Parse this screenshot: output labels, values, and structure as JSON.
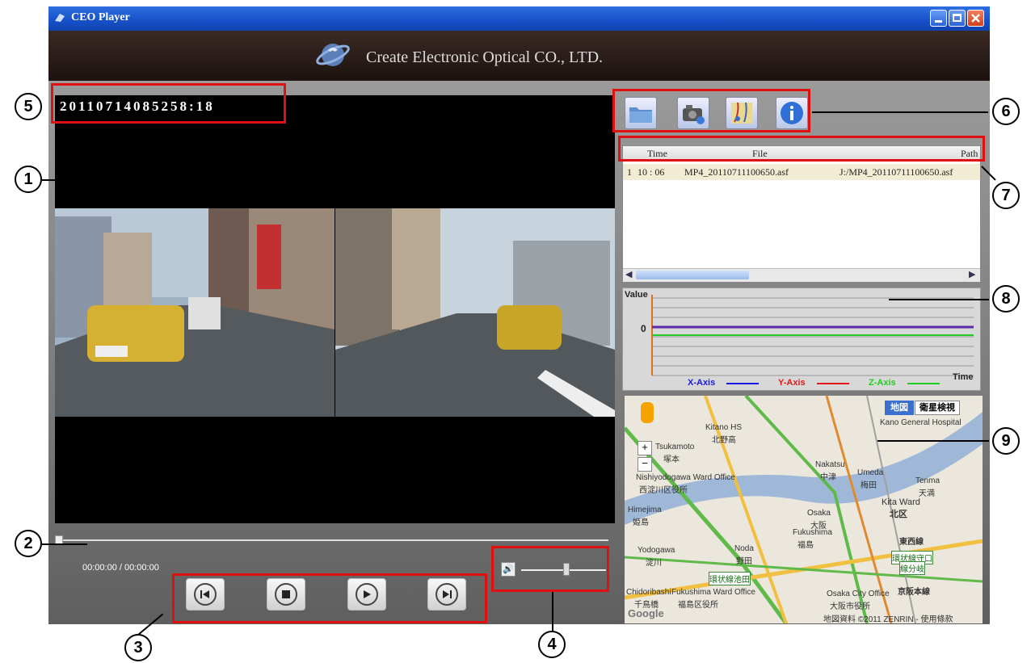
{
  "window": {
    "title": "CEO Player",
    "brand": "Create Electronic Optical CO., LTD."
  },
  "video": {
    "timestamp": "20110714085258:18",
    "time_display": "00:00:00 / 00:00:00"
  },
  "file_table": {
    "columns": [
      "Time",
      "File",
      "Path"
    ],
    "rows": [
      {
        "index": "1",
        "time": "10 : 06",
        "file": "MP4_20110711100650.asf",
        "path": "J:/MP4_20110711100650.asf"
      }
    ]
  },
  "graph": {
    "ylabel": "Value",
    "zero_label": "0",
    "xlabel": "Time",
    "legend": [
      {
        "name": "X-Axis",
        "color": "#1a1ae0"
      },
      {
        "name": "Y-Axis",
        "color": "#e01818"
      },
      {
        "name": "Z-Axis",
        "color": "#22cc22"
      }
    ]
  },
  "map": {
    "btn_map": "地図",
    "btn_satellite": "衛星検視",
    "labels": [
      "Kitano HS",
      "北野高",
      "Tsukamoto",
      "塚本",
      "Nakatsu",
      "中津",
      "Umeda",
      "梅田",
      "Tenma",
      "天満",
      "Kita Ward",
      "北区",
      "Osaka",
      "大阪",
      "Fukushima",
      "福島",
      "Noda",
      "野田",
      "Yodogawa",
      "淀川",
      "Himejima",
      "姫島",
      "東西線",
      "環状線守口",
      "線分岐",
      "京阪本線",
      "環状線池田",
      "Chidoribashi",
      "千鳥橋",
      "Fukushima Ward Office",
      "福島区役所",
      "Osaka City Office",
      "大阪市役所",
      "Nishiyodogawa Ward Office",
      "西淀川区役所",
      "Kano General Hospital",
      "Google"
    ],
    "copyright": "地図資料 ©2011 ZENRIN - 使用條款"
  },
  "callouts": [
    "1",
    "2",
    "3",
    "4",
    "5",
    "6",
    "7",
    "8",
    "9"
  ],
  "colors": {
    "annotation": "#e01010",
    "titlebar": "#1650c8"
  },
  "icons": [
    "open-folder-icon",
    "camera-icon",
    "map-icon",
    "info-icon",
    "skip-back-icon",
    "stop-icon",
    "play-icon",
    "skip-forward-icon",
    "speaker-icon"
  ]
}
